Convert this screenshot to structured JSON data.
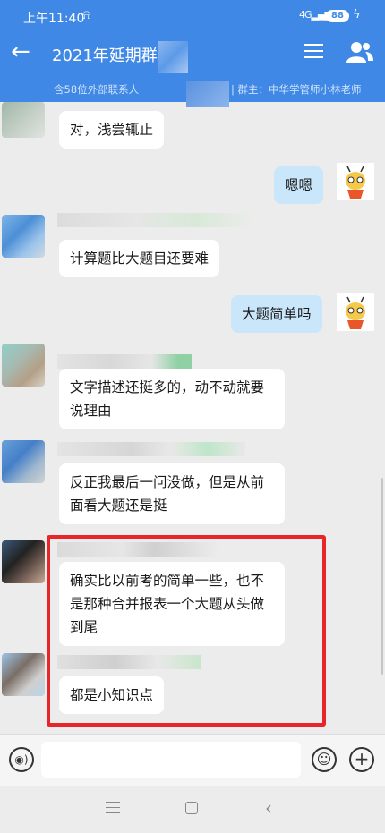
{
  "status": {
    "time": "上午11:40",
    "signal": "4G",
    "battery": "88"
  },
  "header": {
    "title": "2021年延期群",
    "subtitle_left": "含58位外部联系人",
    "subtitle_right": "| 群主：中华学管师小林老师"
  },
  "messages": [
    {
      "side": "left",
      "text": "对，浅尝辄止"
    },
    {
      "side": "right",
      "text": "嗯嗯"
    },
    {
      "side": "left",
      "text": "计算题比大题目还要难"
    },
    {
      "side": "right",
      "text": "大题简单吗"
    },
    {
      "side": "left",
      "text": "文字描述还挺多的，动不动就要说理由"
    },
    {
      "side": "left",
      "text": "反正我最后一问没做，但是从前面看大题还是挺"
    },
    {
      "side": "left",
      "text": "确实比以前考的简单一些，也不是那种合并报表一个大题从头做到尾"
    },
    {
      "side": "left",
      "text": "都是小知识点"
    }
  ],
  "icons": {
    "back": "arrow-left-icon",
    "menu": "menu-icon",
    "members": "person-icon",
    "voice": "voice-icon",
    "emoji": "emoji-icon",
    "plus": "plus-icon"
  },
  "colors": {
    "accent": "#3f88e6",
    "highlight": "#e8262a",
    "my_bubble": "#c9e6fb"
  }
}
